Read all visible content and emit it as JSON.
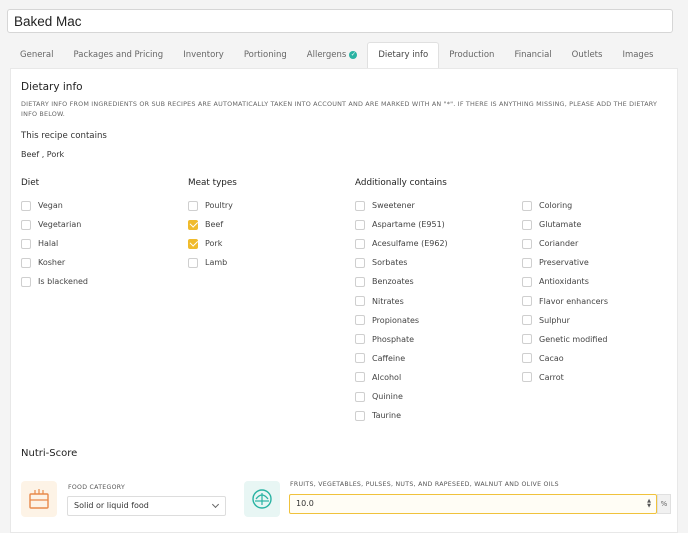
{
  "recipe": {
    "name": "Baked Mac"
  },
  "tabs": [
    {
      "label": "General",
      "active": false
    },
    {
      "label": "Packages and Pricing",
      "active": false
    },
    {
      "label": "Inventory",
      "active": false
    },
    {
      "label": "Portioning",
      "active": false
    },
    {
      "label": "Allergens",
      "active": false,
      "verified": true
    },
    {
      "label": "Dietary info",
      "active": true
    },
    {
      "label": "Production",
      "active": false
    },
    {
      "label": "Financial",
      "active": false
    },
    {
      "label": "Outlets",
      "active": false
    },
    {
      "label": "Images",
      "active": false
    }
  ],
  "dietary": {
    "title": "Dietary info",
    "note": "DIETARY INFO FROM INGREDIENTS OR SUB RECIPES ARE AUTOMATICALLY TAKEN INTO ACCOUNT AND ARE MARKED WITH AN \"*\". IF THERE IS ANYTHING MISSING, PLEASE ADD THE DIETARY INFO BELOW.",
    "contains_label": "This recipe contains",
    "contains_value": "Beef , Pork"
  },
  "diet": {
    "title": "Diet",
    "items": [
      {
        "label": "Vegan",
        "checked": false
      },
      {
        "label": "Vegetarian",
        "checked": false
      },
      {
        "label": "Halal",
        "checked": false
      },
      {
        "label": "Kosher",
        "checked": false
      },
      {
        "label": "Is blackened",
        "checked": false
      }
    ]
  },
  "meat": {
    "title": "Meat types",
    "items": [
      {
        "label": "Poultry",
        "checked": false
      },
      {
        "label": "Beef",
        "checked": true
      },
      {
        "label": "Pork",
        "checked": true
      },
      {
        "label": "Lamb",
        "checked": false
      }
    ]
  },
  "additional": {
    "title": "Additionally contains",
    "col1": [
      {
        "label": "Sweetener",
        "checked": false
      },
      {
        "label": "Aspartame (E951)",
        "checked": false
      },
      {
        "label": "Acesulfame (E962)",
        "checked": false
      },
      {
        "label": "Sorbates",
        "checked": false
      },
      {
        "label": "Benzoates",
        "checked": false
      },
      {
        "label": "Nitrates",
        "checked": false
      },
      {
        "label": "Propionates",
        "checked": false
      },
      {
        "label": "Phosphate",
        "checked": false
      },
      {
        "label": "Caffeine",
        "checked": false
      },
      {
        "label": "Alcohol",
        "checked": false
      },
      {
        "label": "Quinine",
        "checked": false
      },
      {
        "label": "Taurine",
        "checked": false
      }
    ],
    "col2": [
      {
        "label": "Coloring",
        "checked": false
      },
      {
        "label": "Glutamate",
        "checked": false
      },
      {
        "label": "Coriander",
        "checked": false
      },
      {
        "label": "Preservative",
        "checked": false
      },
      {
        "label": "Antioxidants",
        "checked": false
      },
      {
        "label": "Flavor enhancers",
        "checked": false
      },
      {
        "label": "Sulphur",
        "checked": false
      },
      {
        "label": "Genetic modified",
        "checked": false
      },
      {
        "label": "Cacao",
        "checked": false
      },
      {
        "label": "Carrot",
        "checked": false
      }
    ]
  },
  "nutri": {
    "title": "Nutri-Score",
    "food_category_label": "FOOD CATEGORY",
    "food_category_value": "Solid or liquid food",
    "fruits_label": "FRUITS, VEGETABLES, PULSES, NUTS, AND RAPESEED, WALNUT AND OLIVE OILS",
    "fruits_value": "10.0",
    "fruits_unit": "%"
  },
  "colors": {
    "accent": "#f0bb2c",
    "teal": "#2ab3a3",
    "food_icon_bg": "#fdf3e6",
    "food_icon": "#e8894a",
    "fruit_icon_bg": "#e8f6f4"
  }
}
